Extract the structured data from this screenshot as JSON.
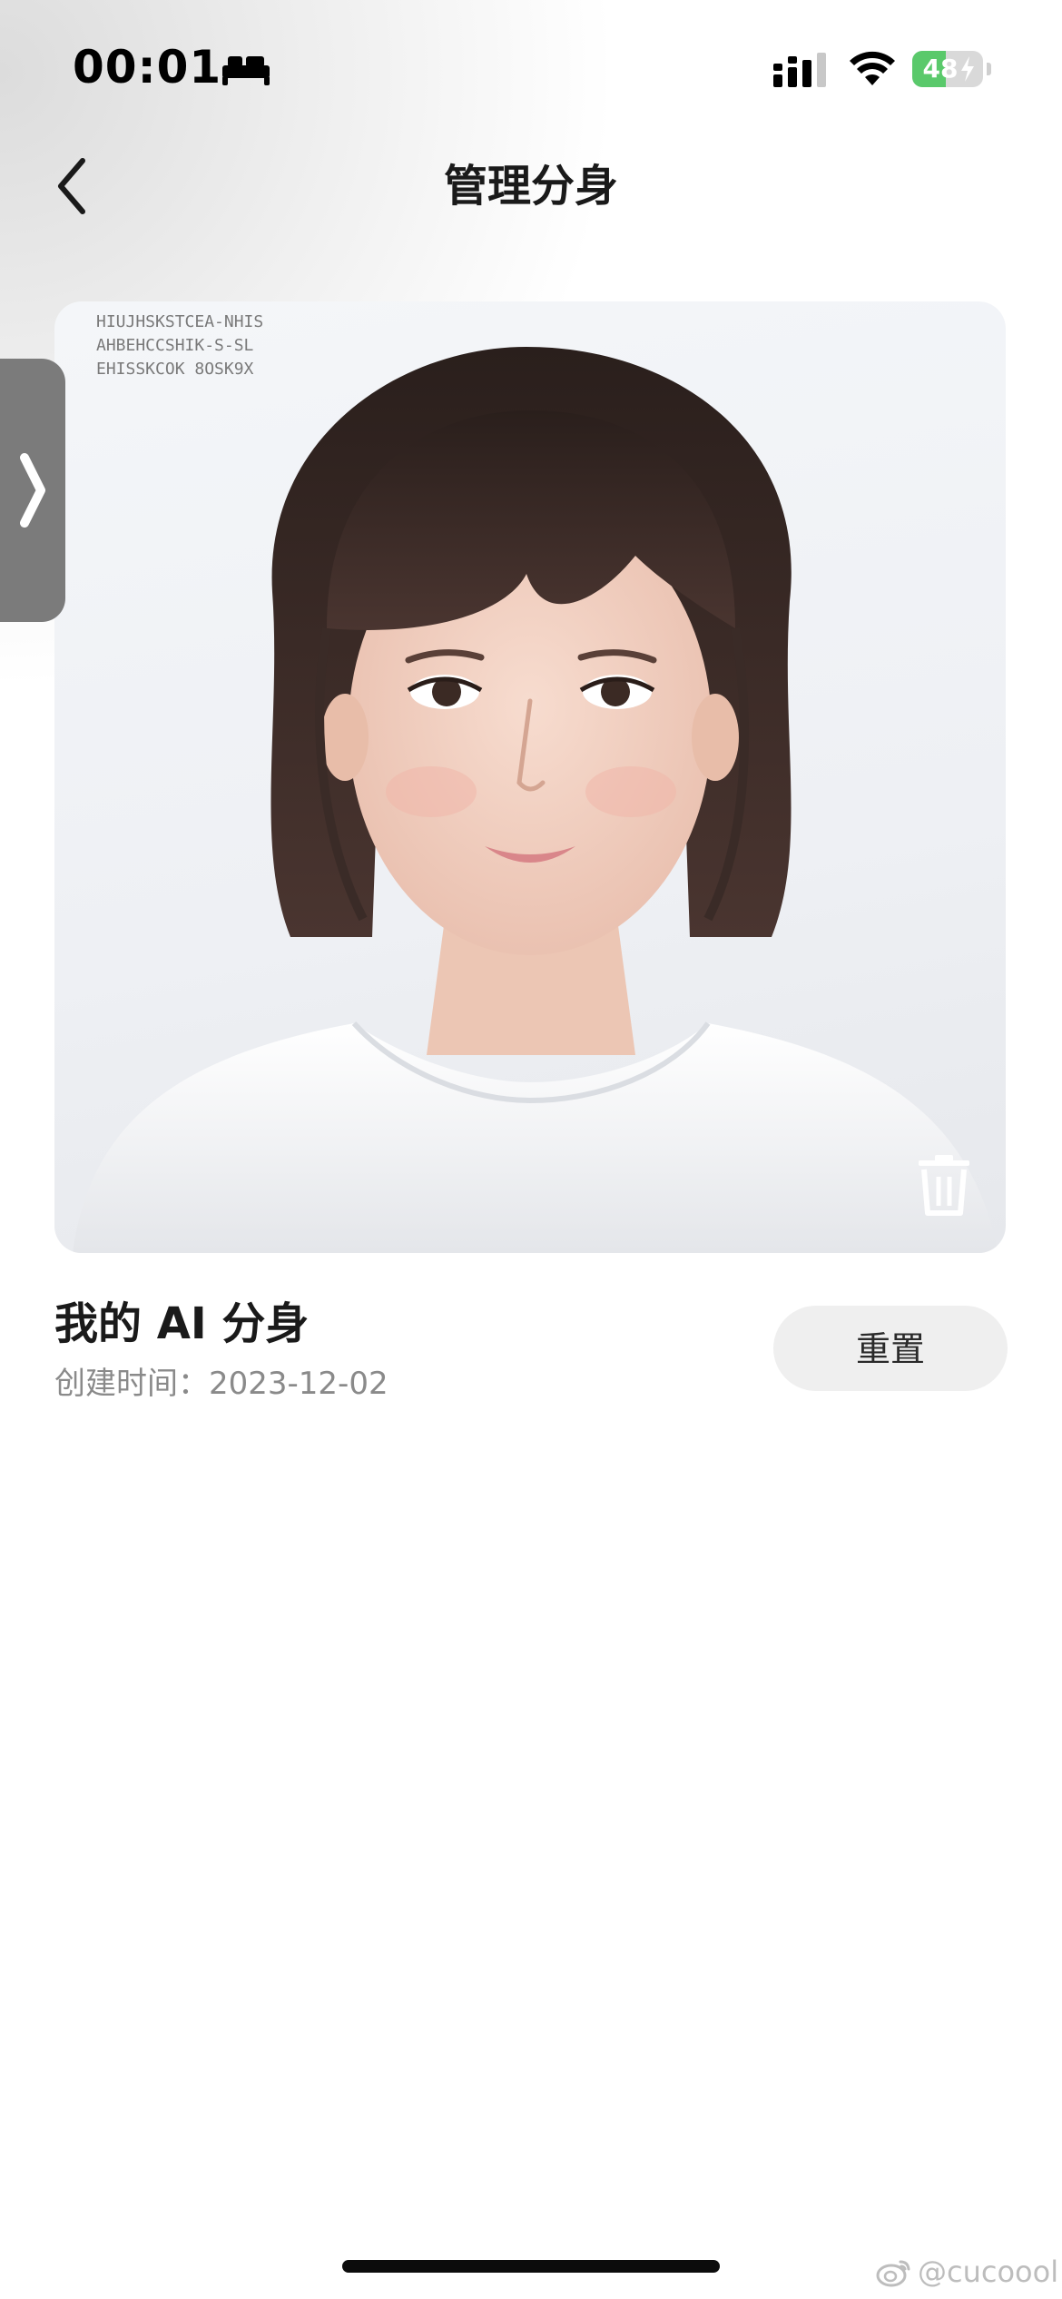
{
  "status_bar": {
    "time": "00:01",
    "battery_level": 48,
    "battery_label": "48",
    "battery_color": "#5ac96b",
    "icons": [
      "bed-icon",
      "cellular-signal-icon",
      "wifi-icon",
      "battery-charging-icon"
    ]
  },
  "nav": {
    "title": "管理分身",
    "back_icon": "chevron-left-icon"
  },
  "avatar_card": {
    "watermark_lines": [
      "HIUJHSKSTCEA-NHIS",
      "AHBEHCCSHIK-S-SL",
      "EHISSKCOK 8OSK9X"
    ],
    "delete_icon": "trash-icon",
    "side_handle_icon": "chevron-right-icon"
  },
  "info": {
    "name": "我的 AI 分身",
    "created_label": "创建时间：",
    "created_date": "2023-12-02",
    "reset_label": "重置"
  },
  "footer": {
    "watermark_handle": "@cucoool",
    "watermark_icon": "weibo-icon"
  }
}
